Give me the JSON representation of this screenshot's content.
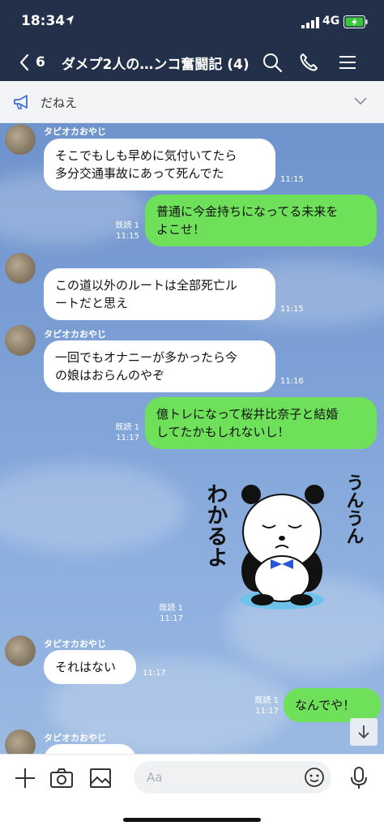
{
  "status": {
    "time": "18:34",
    "network": "4G"
  },
  "header": {
    "back_count": "6",
    "title": "ダメプ2人の…ンコ奮闘記 (4)"
  },
  "announcement": {
    "text": "だねえ"
  },
  "messages": [
    {
      "type": "in",
      "sender": "タピオカおやじ",
      "lines": [
        "そこでもしも早めに気付いてたら",
        "多分交通事故にあって死んでた"
      ],
      "time": "11:15"
    },
    {
      "type": "out",
      "lines": [
        "普通に今金持ちになってる未来を",
        "よこせ！"
      ],
      "read": "既読 1",
      "time": "11:15"
    },
    {
      "type": "in",
      "sender": "タピオカおやじ",
      "lines": [
        "この道以外のルートは全部死亡ル",
        "ートだと思え"
      ],
      "time": "11:15"
    },
    {
      "type": "in",
      "sender": "タピオカおやじ",
      "lines": [
        "一回でもオナニーが多かったら今",
        "の娘はおらんのやぞ"
      ],
      "time": "11:16"
    },
    {
      "type": "out",
      "lines": [
        "億トレになって桜井比奈子と結婚",
        "してたかもしれないし！"
      ],
      "read": "既読 1",
      "time": "11:17"
    },
    {
      "type": "sticker",
      "text_left": "わかるよ",
      "text_right": "うんうん",
      "read": "既読 1",
      "time": "11:17"
    },
    {
      "type": "in",
      "sender": "タピオカおやじ",
      "lines": [
        "それはない"
      ],
      "time": "11:17"
    },
    {
      "type": "out",
      "lines": [
        "なんでや！"
      ],
      "read": "既読 1",
      "time": "11:17"
    },
    {
      "type": "in",
      "sender": "タピオカおやじ",
      "lines": []
    }
  ],
  "input": {
    "placeholder": "Aa"
  },
  "icons": [
    "location-arrow-icon",
    "signal-icon",
    "battery-charging-icon",
    "back-chevron-icon",
    "search-icon",
    "phone-icon",
    "menu-icon",
    "megaphone-icon",
    "chevron-down-icon",
    "arrow-down-icon",
    "plus-icon",
    "camera-icon",
    "image-icon",
    "emoji-icon",
    "mic-icon"
  ],
  "colors": {
    "header": "#233049",
    "out_bubble": "#6ee05a",
    "in_bubble": "#ffffff",
    "battery": "#3ac83a"
  }
}
